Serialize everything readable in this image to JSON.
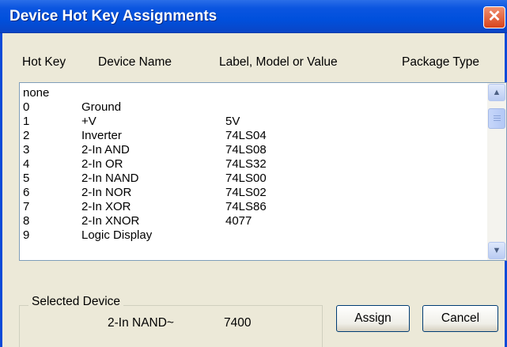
{
  "window": {
    "title": "Device Hot Key Assignments",
    "close_glyph": "✕"
  },
  "columns": {
    "hot_key": "Hot Key",
    "device_name": "Device Name",
    "label": "Label, Model or Value",
    "package": "Package Type"
  },
  "rows": [
    {
      "key": "none",
      "name": "",
      "value": ""
    },
    {
      "key": "0",
      "name": "Ground",
      "value": ""
    },
    {
      "key": "1",
      "name": "+V",
      "value": "5V"
    },
    {
      "key": "2",
      "name": "Inverter",
      "value": "74LS04"
    },
    {
      "key": "3",
      "name": "2-In AND",
      "value": "74LS08"
    },
    {
      "key": "4",
      "name": "2-In OR",
      "value": "74LS32"
    },
    {
      "key": "5",
      "name": "2-In NAND",
      "value": "74LS00"
    },
    {
      "key": "6",
      "name": "2-In NOR",
      "value": "74LS02"
    },
    {
      "key": "7",
      "name": "2-In XOR",
      "value": "74LS86"
    },
    {
      "key": "8",
      "name": "2-In XNOR",
      "value": "4077"
    },
    {
      "key": "9",
      "name": "Logic Display",
      "value": ""
    }
  ],
  "selected_device": {
    "legend": "Selected Device",
    "name": "2-In NAND~",
    "value": "7400"
  },
  "buttons": {
    "assign": "Assign",
    "cancel": "Cancel"
  },
  "scrollbar": {
    "up_glyph": "▲",
    "down_glyph": "▼"
  }
}
